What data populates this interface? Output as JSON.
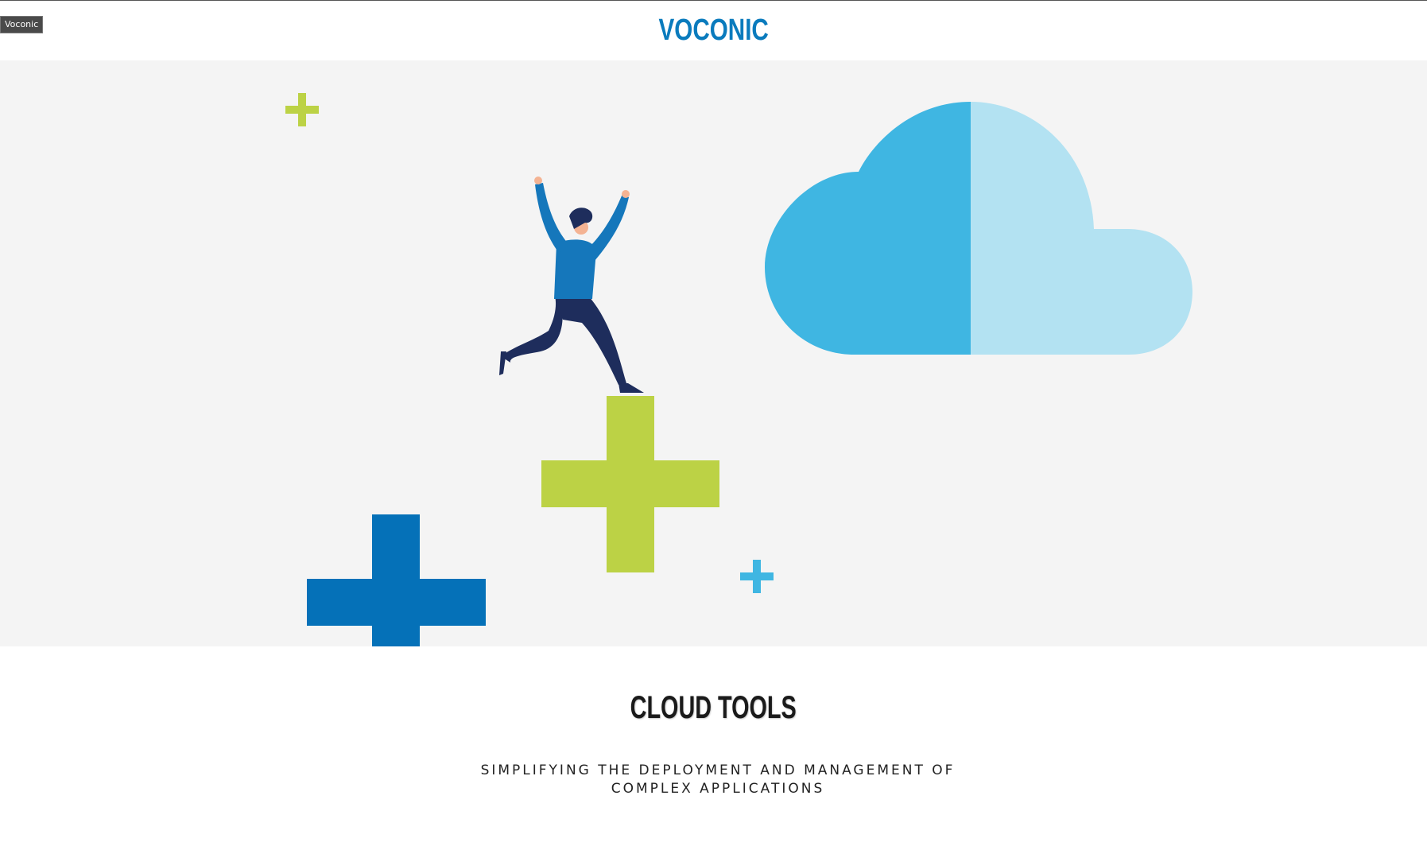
{
  "tooltip": "Voconic",
  "header": {
    "logo": "VOCONIC"
  },
  "hero": {
    "colors": {
      "background": "#f4f4f4",
      "cloud_left": "#3fb6e2",
      "cloud_right": "#b3e2f2",
      "green_plus": "#bcd245",
      "blue_plus": "#0571b8",
      "light_blue_plus": "#3fb6e2",
      "person_shirt": "#1577bb",
      "person_pants": "#1e2d5c"
    },
    "illustration": [
      "plus-icon",
      "person-jumping",
      "cloud-icon"
    ]
  },
  "section": {
    "title": "CLOUD TOOLS",
    "subtitle_line1": "SIMPLIFYING THE DEPLOYMENT AND MANAGEMENT OF",
    "subtitle_line2": "COMPLEX APPLICATIONS"
  }
}
